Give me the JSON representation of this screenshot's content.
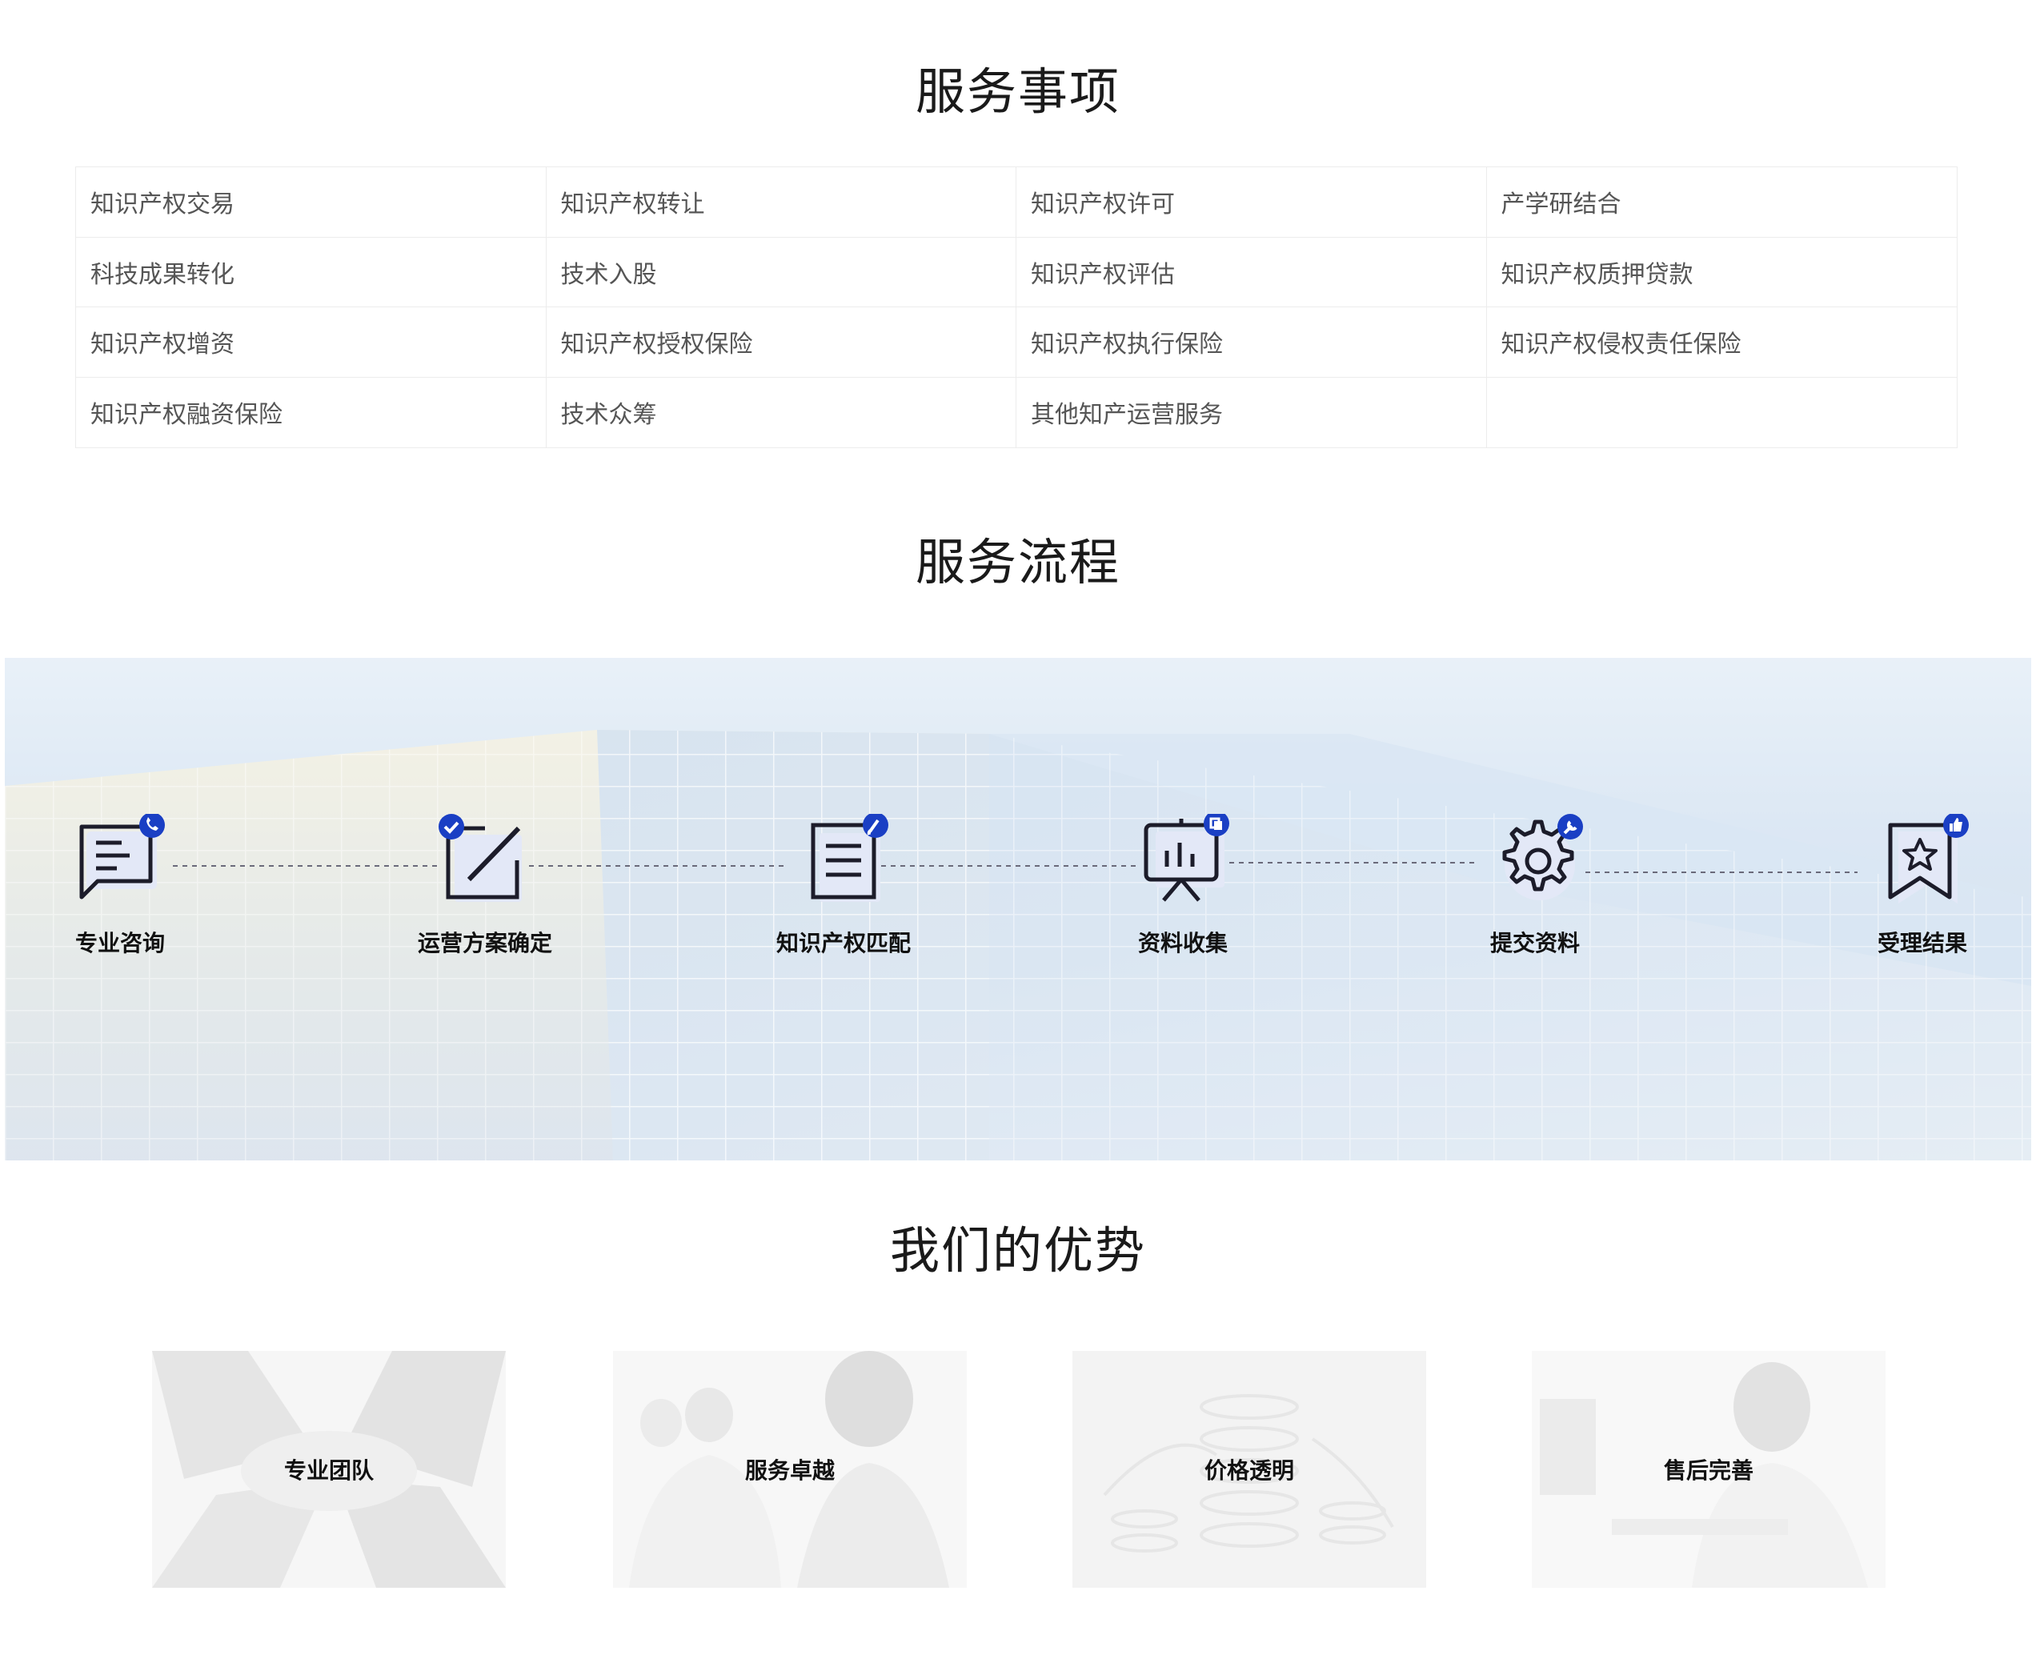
{
  "sections": {
    "services_title": "服务事项",
    "process_title": "服务流程",
    "advantages_title": "我们的优势"
  },
  "services": [
    "知识产权交易",
    "知识产权转让",
    "知识产权许可",
    "产学研结合",
    "科技成果转化",
    "技术入股",
    "知识产权评估",
    "知识产权质押贷款",
    "知识产权增资",
    "知识产权授权保险",
    "知识产权执行保险",
    "知识产权侵权责任保险",
    "知识产权融资保险",
    "技术众筹",
    "其他知产运营服务",
    ""
  ],
  "process_steps": [
    {
      "label": "专业咨询",
      "icon": "chat-phone-icon"
    },
    {
      "label": "运营方案确定",
      "icon": "edit-check-icon"
    },
    {
      "label": "知识产权匹配",
      "icon": "document-brush-icon"
    },
    {
      "label": "资料收集",
      "icon": "presentation-chart-icon"
    },
    {
      "label": "提交资料",
      "icon": "gear-wrench-icon"
    },
    {
      "label": "受理结果",
      "icon": "bookmark-star-icon"
    }
  ],
  "advantages": [
    {
      "label": "专业团队"
    },
    {
      "label": "服务卓越"
    },
    {
      "label": "价格透明"
    },
    {
      "label": "售后完善"
    }
  ],
  "colors": {
    "accent": "#1a3fc4",
    "icon_stroke": "#1c1c2a",
    "icon_fill": "#e3e8f7"
  }
}
